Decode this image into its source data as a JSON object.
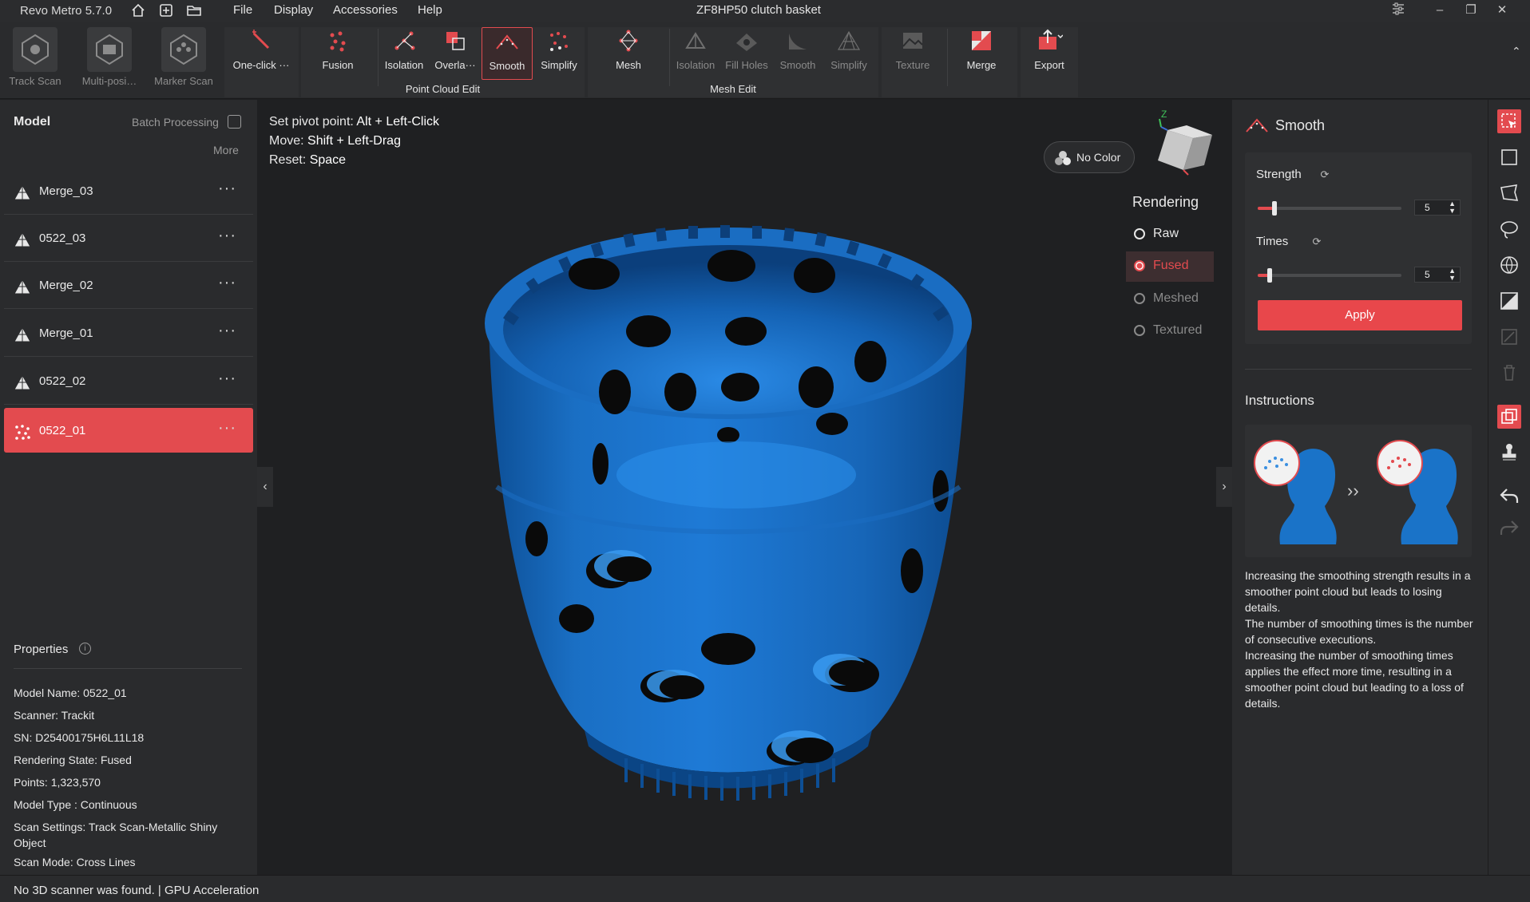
{
  "app": {
    "name": "Revo Metro 5.7.0",
    "document_title": "ZF8HP50 clutch basket"
  },
  "menu": [
    "File",
    "Display",
    "Accessories",
    "Help"
  ],
  "toolbar": {
    "scan_buttons": [
      "Track Scan",
      "Multi-posi…",
      "Marker Scan"
    ],
    "one_click": "One-click ···",
    "point_cloud_edit": {
      "label": "Point Cloud Edit",
      "items": [
        "Fusion",
        "Isolation",
        "Overla···",
        "Smooth",
        "Simplify"
      ]
    },
    "mesh_edit": {
      "label": "Mesh Edit",
      "items": [
        "Mesh",
        "Isolation",
        "Fill Holes",
        "Smooth",
        "Simplify"
      ]
    },
    "texture": "Texture",
    "merge": "Merge",
    "export": "Export"
  },
  "left_panel": {
    "title": "Model",
    "batch_processing": "Batch Processing",
    "more": "More",
    "models": [
      {
        "name": "Merge_03",
        "selected": false
      },
      {
        "name": "0522_03",
        "selected": false
      },
      {
        "name": "Merge_02",
        "selected": false
      },
      {
        "name": "Merge_01",
        "selected": false
      },
      {
        "name": "0522_02",
        "selected": false
      },
      {
        "name": "0522_01",
        "selected": true
      }
    ],
    "properties_title": "Properties",
    "properties": [
      "Model Name:  0522_01",
      "Scanner:  Trackit",
      "SN:  D25400175H6L11L18",
      "Rendering State:  Fused",
      "Points:  1,323,570",
      "Model Type :  Continuous",
      "Scan Settings:  Track Scan-Metallic Shiny Object",
      "Scan Mode:  Cross Lines"
    ]
  },
  "viewport": {
    "hints": [
      {
        "label": "Set pivot point:",
        "keys": "Alt + Left-Click"
      },
      {
        "label": "Move:",
        "keys": "Shift + Left-Drag"
      },
      {
        "label": "Reset:",
        "keys": "Space"
      }
    ],
    "no_color": "No Color",
    "rendering_title": "Rendering",
    "rendering_options": [
      {
        "label": "Raw",
        "state": "normal"
      },
      {
        "label": "Fused",
        "state": "selected"
      },
      {
        "label": "Meshed",
        "state": "disabled"
      },
      {
        "label": "Textured",
        "state": "disabled"
      }
    ],
    "axis_label": "Z",
    "model_color": "#1a73c8"
  },
  "right_panel": {
    "title": "Smooth",
    "strength_label": "Strength",
    "strength_value": "5",
    "times_label": "Times",
    "times_value": "5",
    "apply": "Apply",
    "instructions_title": "Instructions",
    "instructions_text": "Increasing the smoothing strength results in a smoother point cloud but leads to losing details.\nThe number of smoothing times is the number of consecutive executions.\nIncreasing the number of smoothing times applies the effect more time, resulting in a smoother point cloud but leading to a loss of details."
  },
  "status": "No 3D scanner was found.  | GPU Acceleration",
  "colors": {
    "accent": "#e34b4f",
    "background": "#1f2022",
    "panel": "#2a2b2d"
  }
}
